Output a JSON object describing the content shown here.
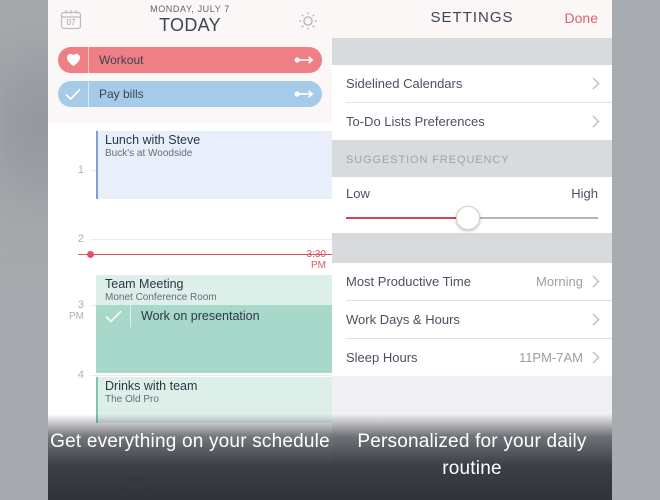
{
  "left_panel": {
    "header": {
      "calendar_icon_day": "07",
      "date_line": "MONDAY, JULY 7",
      "today_label": "TODAY",
      "settings_icon": "gear-icon"
    },
    "todos": [
      {
        "label": "Workout",
        "icon": "heart-icon",
        "color": "#ef7e85",
        "arrow_icon": "arrow-right-icon"
      },
      {
        "label": "Pay bills",
        "icon": "check-icon",
        "color": "#a6cbe8",
        "arrow_icon": "arrow-right-icon"
      }
    ],
    "hour_labels": [
      {
        "hour": "1",
        "ampm": ""
      },
      {
        "hour": "2",
        "ampm": ""
      },
      {
        "hour": "3",
        "ampm": "PM"
      },
      {
        "hour": "4",
        "ampm": ""
      }
    ],
    "now_marker": {
      "time": "3:30",
      "ampm": "PM",
      "color": "#e05362"
    },
    "events": [
      {
        "title": "Lunch with Steve",
        "location": "Buck's at Woodside",
        "accent": "#7d9fd3",
        "bg": "#e9effa"
      },
      {
        "title": "Team Meeting",
        "location": "Monet Conference Room",
        "accent": "#7fc4b0",
        "bg": "#ddefe9"
      },
      {
        "title": "Drinks with team",
        "location": "The Old Pro",
        "accent": "#7fc4b0",
        "bg": "#ddefe9"
      }
    ],
    "task_block": {
      "label": "Work on presentation",
      "icon": "check-icon",
      "bg": "#a7d8ca"
    },
    "caption": "Get everything on your schedule"
  },
  "right_panel": {
    "header": {
      "title": "SETTINGS",
      "done_label": "Done",
      "done_color": "#e4606d"
    },
    "group_one": [
      {
        "label": "Sidelined Calendars",
        "value": "",
        "chevron": "chevron-right-icon"
      },
      {
        "label": "To-Do Lists Preferences",
        "value": "",
        "chevron": "chevron-right-icon"
      }
    ],
    "suggestion_frequency": {
      "section_title": "SUGGESTION FREQUENCY",
      "low_label": "Low",
      "high_label": "High",
      "value_percent": 48,
      "fill_color": "#cf4552"
    },
    "group_two": [
      {
        "label": "Most Productive Time",
        "value": "Morning",
        "chevron": "chevron-right-icon"
      },
      {
        "label": "Work Days & Hours",
        "value": "",
        "chevron": "chevron-right-icon"
      },
      {
        "label": "Sleep Hours",
        "value": "11PM-7AM",
        "chevron": "chevron-right-icon"
      }
    ],
    "caption": "Personalized for your daily routine"
  }
}
